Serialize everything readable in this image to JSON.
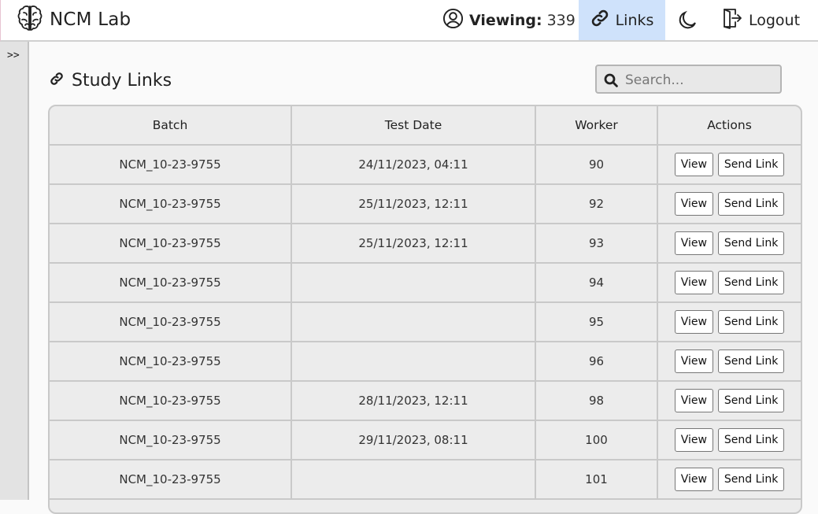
{
  "app": {
    "name": "NCM Lab"
  },
  "nav": {
    "viewing_label": "Viewing:",
    "viewing_count": "339",
    "links_label": "Links",
    "logout_label": "Logout"
  },
  "sidebar": {
    "toggle_label": ">>"
  },
  "page": {
    "title": "Study Links"
  },
  "search": {
    "placeholder": "Search..."
  },
  "table": {
    "headers": [
      "Batch",
      "Test Date",
      "Worker",
      "Actions"
    ],
    "rows": [
      {
        "batch": "NCM_10-23-9755",
        "test_date": "24/11/2023, 04:11",
        "worker": "90"
      },
      {
        "batch": "NCM_10-23-9755",
        "test_date": "25/11/2023, 12:11",
        "worker": "92"
      },
      {
        "batch": "NCM_10-23-9755",
        "test_date": "25/11/2023, 12:11",
        "worker": "93"
      },
      {
        "batch": "NCM_10-23-9755",
        "test_date": "",
        "worker": "94"
      },
      {
        "batch": "NCM_10-23-9755",
        "test_date": "",
        "worker": "95"
      },
      {
        "batch": "NCM_10-23-9755",
        "test_date": "",
        "worker": "96"
      },
      {
        "batch": "NCM_10-23-9755",
        "test_date": "28/11/2023, 12:11",
        "worker": "98"
      },
      {
        "batch": "NCM_10-23-9755",
        "test_date": "29/11/2023, 08:11",
        "worker": "100"
      },
      {
        "batch": "NCM_10-23-9755",
        "test_date": "",
        "worker": "101"
      }
    ],
    "view_label": "View",
    "send_label": "Send Link"
  },
  "colors": {
    "active_nav_bg": "#cfe2fb",
    "sidebar_bg": "#e3e3e3",
    "table_bg": "#ececec"
  },
  "icons": [
    "brain-icon",
    "user-circle-icon",
    "link-icon",
    "moon-icon",
    "logout-icon",
    "search-icon"
  ]
}
